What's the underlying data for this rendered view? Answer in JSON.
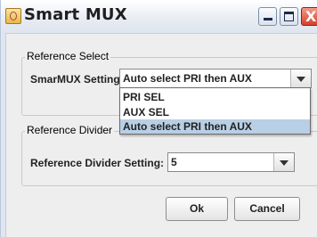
{
  "window": {
    "title": "Smart MUX",
    "close_glyph": "X"
  },
  "reference_select": {
    "legend": "Reference Select",
    "setting_label": "SmarMUX Setting:",
    "selected_value": "Auto select PRI then AUX",
    "options": [
      "PRI SEL",
      "AUX SEL",
      "Auto select PRI then AUX"
    ]
  },
  "reference_divider": {
    "legend": "Reference Divider",
    "setting_label": "Reference Divider Setting:",
    "selected_value": "5"
  },
  "buttons": {
    "ok": "Ok",
    "cancel": "Cancel"
  },
  "icons": {
    "app": "app-icon",
    "minimize": "minimize-icon",
    "maximize": "maximize-icon",
    "close": "close-icon",
    "dropdown": "chevron-down-icon"
  },
  "colors": {
    "dialog_bg": "#eeeeee",
    "selection_highlight": "#b8cfe5",
    "close_button": "#d6402a"
  }
}
